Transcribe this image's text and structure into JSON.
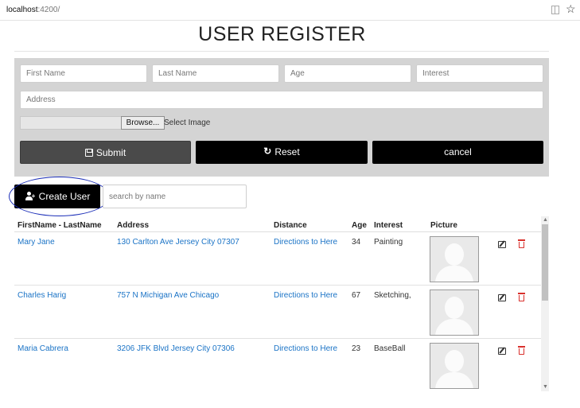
{
  "browser": {
    "url_host": "localhost",
    "url_path": ":4200/"
  },
  "page_title": "USER REGISTER",
  "form": {
    "first_name_placeholder": "First Name",
    "last_name_placeholder": "Last Name",
    "age_placeholder": "Age",
    "interest_placeholder": "Interest",
    "address_placeholder": "Address",
    "browse_label": "Browse...",
    "file_label": "Select Image",
    "submit_label": "Submit",
    "reset_label": "Reset",
    "cancel_label": "cancel"
  },
  "toolbar": {
    "create_label": "Create User",
    "search_placeholder": "search by name"
  },
  "table": {
    "headers": [
      "FirstName - LastName",
      "Address",
      "Distance",
      "Age",
      "Interest",
      "Picture"
    ],
    "rows": [
      {
        "name": "Mary Jane",
        "address": "130 Carlton Ave Jersey City 07307",
        "distance": "Directions to Here",
        "age": "34",
        "interest": "Painting"
      },
      {
        "name": "Charles Harig",
        "address": "757 N Michigan Ave Chicago",
        "distance": "Directions to Here",
        "age": "67",
        "interest": "Sketching,"
      },
      {
        "name": "Maria Cabrera",
        "address": "3206 JFK Blvd Jersey City 07306",
        "distance": "Directions to Here",
        "age": "23",
        "interest": "BaseBall"
      }
    ]
  },
  "colors": {
    "link": "#1a73c6",
    "delete": "#d9302c",
    "panel": "#d4d4d4",
    "annotation_ring": "#1c2fb8"
  },
  "icons": {
    "submit": "floppy-disk-icon",
    "reset": "refresh-icon",
    "create": "user-plus-icon",
    "edit": "edit-icon",
    "delete": "trash-icon"
  }
}
